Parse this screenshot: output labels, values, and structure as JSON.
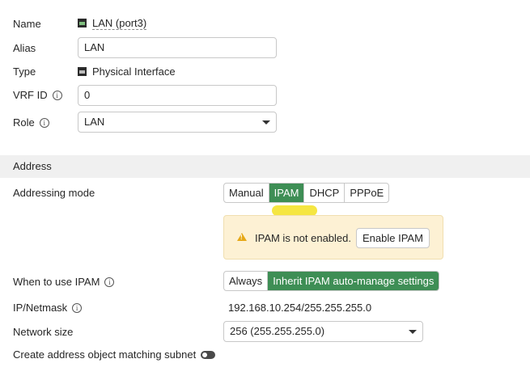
{
  "fields": {
    "name_label": "Name",
    "name_value": "LAN (port3)",
    "alias_label": "Alias",
    "alias_value": "LAN",
    "type_label": "Type",
    "type_value": "Physical Interface",
    "vrf_label": "VRF ID",
    "vrf_value": "0",
    "role_label": "Role",
    "role_value": "LAN"
  },
  "address_section": {
    "title": "Address",
    "addressing_mode_label": "Addressing mode",
    "modes": [
      "Manual",
      "IPAM",
      "DHCP",
      "PPPoE"
    ],
    "active_mode": "IPAM",
    "warning_text": "IPAM is not enabled.",
    "enable_button": "Enable IPAM",
    "when_to_use_label": "When to use IPAM",
    "when_options": [
      "Always",
      "Inherit IPAM auto-manage settings"
    ],
    "active_when": "Inherit IPAM auto-manage settings",
    "ip_label": "IP/Netmask",
    "ip_value": "192.168.10.254/255.255.255.0",
    "network_size_label": "Network size",
    "network_size_value": "256 (255.255.255.0)",
    "create_object_label": "Create address object matching subnet",
    "create_object_enabled": false
  },
  "colors": {
    "accent_green": "#3e8e55",
    "warning_bg": "#fdf1d4",
    "highlight_yellow": "#f5e642"
  },
  "icons": {
    "port": "port-icon",
    "info": "info-icon",
    "warning": "warning-icon",
    "dropdown": "chevron-down-icon"
  }
}
